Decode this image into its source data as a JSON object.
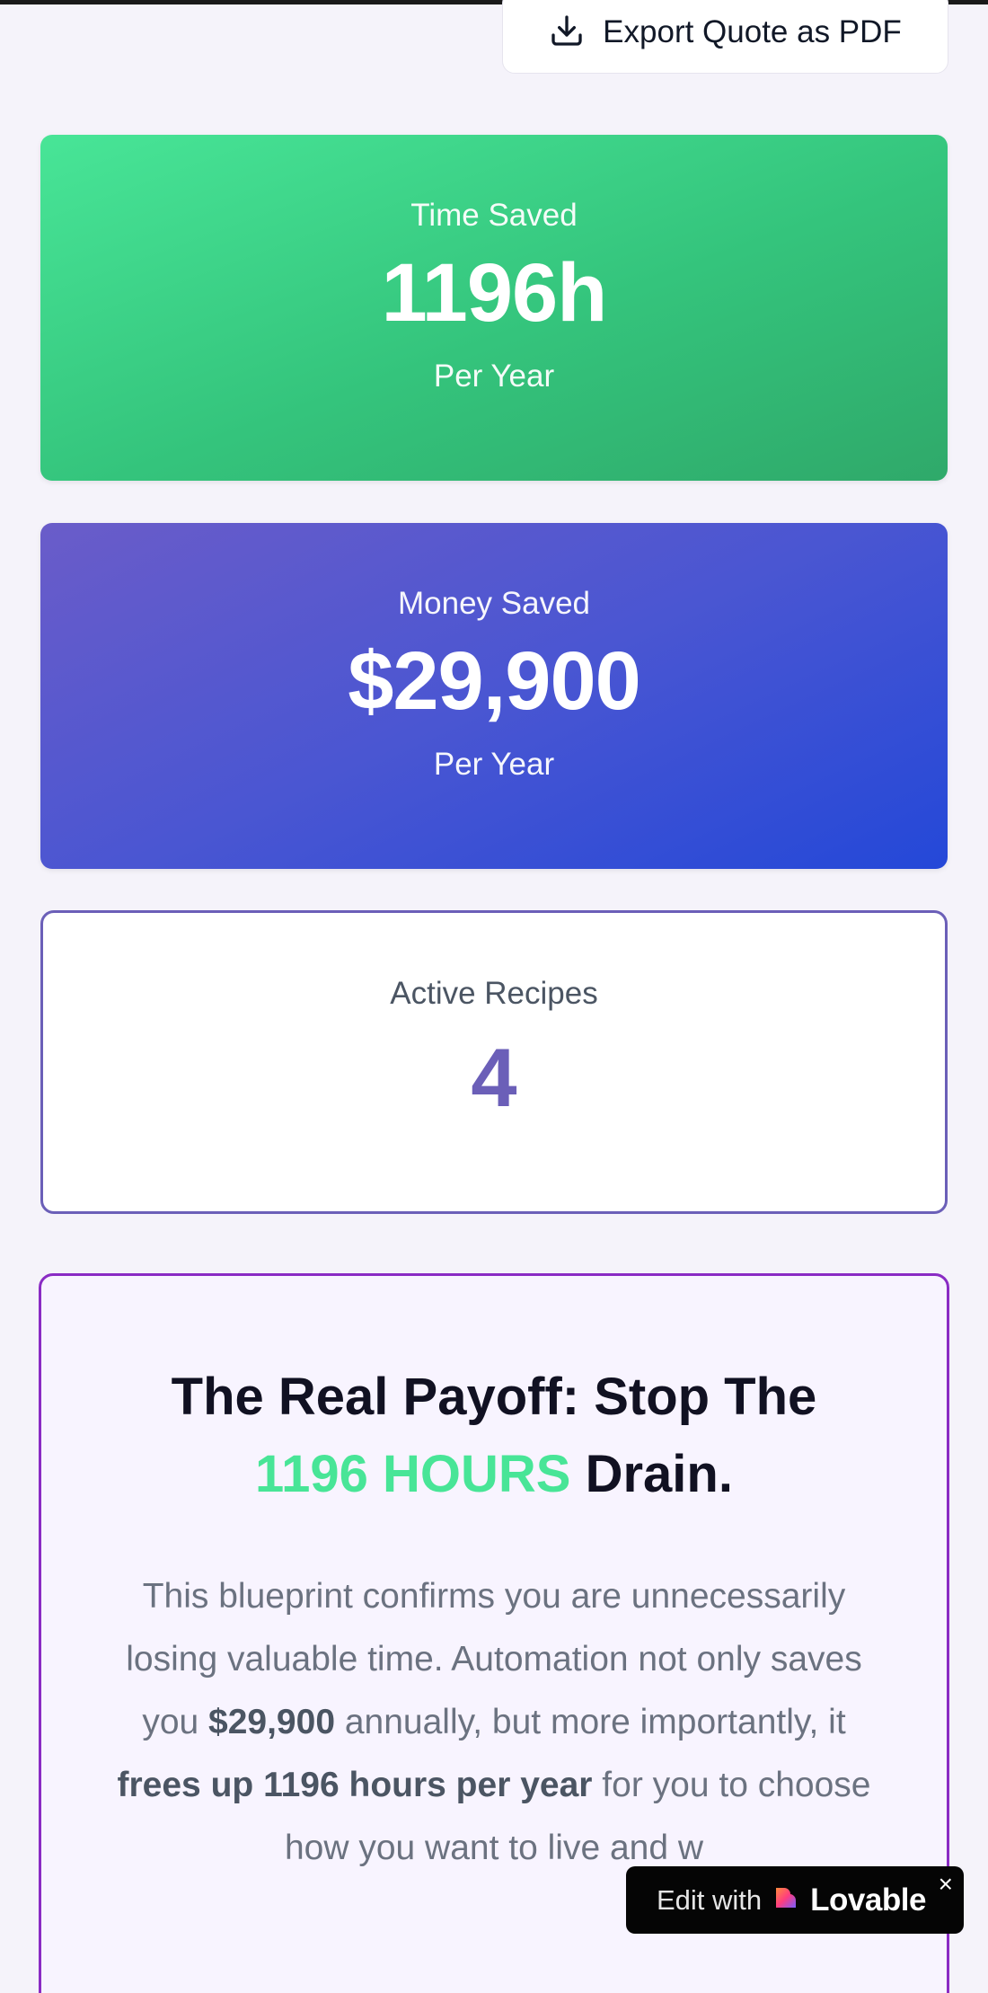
{
  "export": {
    "label": "Export Quote as PDF",
    "icon": "download-icon"
  },
  "time_card": {
    "label": "Time Saved",
    "value": "1196h",
    "sub": "Per Year",
    "colors": [
      "#48e597",
      "#2fa96a"
    ]
  },
  "money_card": {
    "label": "Money Saved",
    "value": "$29,900",
    "sub": "Per Year",
    "colors": [
      "#6a5cc9",
      "#2448d8"
    ]
  },
  "recipes_card": {
    "label": "Active Recipes",
    "value": "4",
    "accent": "#6b5fb8"
  },
  "payoff": {
    "title_a": "The Real Payoff: Stop The",
    "title_highlight": "1196 HOURS",
    "title_b": "Drain.",
    "body_1": "This blueprint confirms you are unnecessarily losing valuable time. Automation not only saves you ",
    "body_money": "$29,900",
    "body_2": " annually, but more importantly, it ",
    "body_bold": "frees up 1196 hours per year",
    "body_3": " for you to choose how you want to live and w",
    "border_color": "#8a2bc4",
    "highlight_color": "#48e597"
  },
  "badge": {
    "prefix": "Edit with",
    "brand": "Lovable",
    "close": "×",
    "icon": "lovable-heart-icon"
  }
}
